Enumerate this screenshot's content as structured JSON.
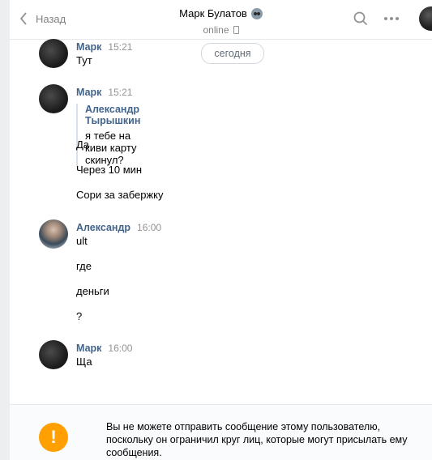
{
  "header": {
    "back_label": "Назад",
    "chat_name": "Марк Булатов",
    "status": "online"
  },
  "day_separator": "сегодня",
  "messages": [
    {
      "author": "Марк",
      "time": "15:21",
      "texts": [
        "Тут"
      ]
    },
    {
      "author": "Марк",
      "time": "15:21",
      "quote": {
        "author": "Александр Тырышкин",
        "text": "я тебе на киви карту скинул?"
      },
      "texts": [
        "Да",
        "Через 10 мин",
        "Сори за забержку"
      ]
    },
    {
      "author": "Александр",
      "time": "16:00",
      "texts": [
        "ult",
        "где",
        "деньги",
        "?"
      ]
    },
    {
      "author": "Марк",
      "time": "16:00",
      "texts": [
        "Ща"
      ]
    }
  ],
  "notice": {
    "icon": "!",
    "text": "Вы не можете отправить сообщение этому пользователю, поскольку он ограничил круг лиц, которые могут присылать ему сообщения."
  },
  "colors": {
    "author_link": "#42648b",
    "warning": "#ffa000",
    "page_bg": "#edeef0"
  }
}
